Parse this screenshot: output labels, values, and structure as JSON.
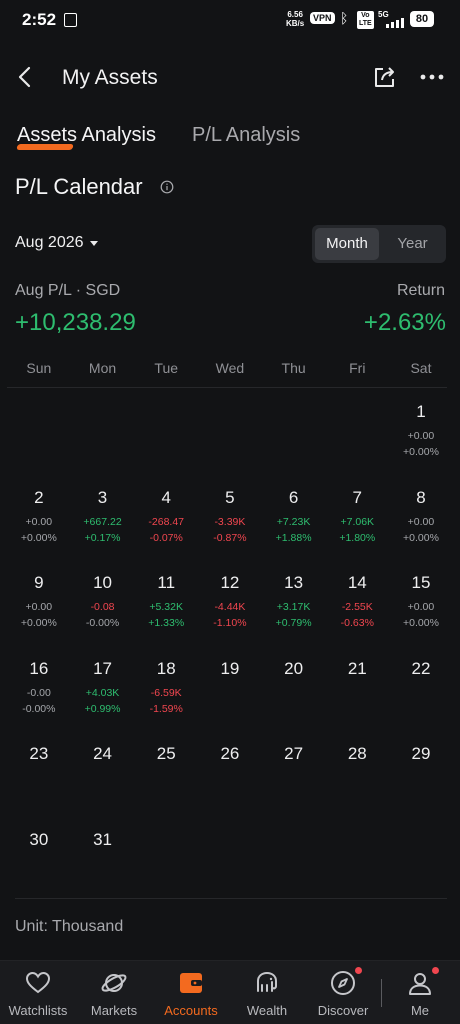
{
  "status_bar": {
    "time": "2:52",
    "net_speed": "6.56",
    "net_unit": "KB/s",
    "vpn": "VPN",
    "volte_top": "Vo",
    "volte_bottom": "LTE",
    "network": "5G",
    "battery": "80"
  },
  "header": {
    "title": "My Assets",
    "back_icon": "chevron-left-icon",
    "share_icon": "share-icon",
    "more_icon": "more-dots-icon"
  },
  "tabs": [
    {
      "label": "Assets Analysis",
      "active": true
    },
    {
      "label": "P/L Analysis",
      "active": false
    }
  ],
  "section": {
    "title": "P/L Calendar",
    "info_icon": "info-icon"
  },
  "period": {
    "selected": "Aug 2026",
    "toggle": [
      "Month",
      "Year"
    ],
    "toggle_active": "Month"
  },
  "summary": {
    "pl_label": "Aug P/L · SGD",
    "pl_value": "+10,238.29",
    "return_label": "Return",
    "return_value": "+2.63%"
  },
  "calendar": {
    "weekdays": [
      "Sun",
      "Mon",
      "Tue",
      "Wed",
      "Thu",
      "Fri",
      "Sat"
    ],
    "weeks": [
      [
        null,
        null,
        null,
        null,
        null,
        null,
        {
          "day": "1",
          "value": "+0.00",
          "pct": "+0.00%",
          "tone": "neutral"
        }
      ],
      [
        {
          "day": "2",
          "value": "+0.00",
          "pct": "+0.00%",
          "tone": "neutral"
        },
        {
          "day": "3",
          "value": "+667.22",
          "pct": "+0.17%",
          "tone": "pos"
        },
        {
          "day": "4",
          "value": "-268.47",
          "pct": "-0.07%",
          "tone": "neg"
        },
        {
          "day": "5",
          "value": "-3.39K",
          "pct": "-0.87%",
          "tone": "neg"
        },
        {
          "day": "6",
          "value": "+7.23K",
          "pct": "+1.88%",
          "tone": "pos"
        },
        {
          "day": "7",
          "value": "+7.06K",
          "pct": "+1.80%",
          "tone": "pos"
        },
        {
          "day": "8",
          "value": "+0.00",
          "pct": "+0.00%",
          "tone": "neutral"
        }
      ],
      [
        {
          "day": "9",
          "value": "+0.00",
          "pct": "+0.00%",
          "tone": "neutral"
        },
        {
          "day": "10",
          "value": "-0.08",
          "pct": "-0.00%",
          "tone": "neg-neutral"
        },
        {
          "day": "11",
          "value": "+5.32K",
          "pct": "+1.33%",
          "tone": "pos"
        },
        {
          "day": "12",
          "value": "-4.44K",
          "pct": "-1.10%",
          "tone": "neg"
        },
        {
          "day": "13",
          "value": "+3.17K",
          "pct": "+0.79%",
          "tone": "pos"
        },
        {
          "day": "14",
          "value": "-2.55K",
          "pct": "-0.63%",
          "tone": "neg"
        },
        {
          "day": "15",
          "value": "+0.00",
          "pct": "+0.00%",
          "tone": "neutral"
        }
      ],
      [
        {
          "day": "16",
          "value": "-0.00",
          "pct": "-0.00%",
          "tone": "neutral"
        },
        {
          "day": "17",
          "value": "+4.03K",
          "pct": "+0.99%",
          "tone": "pos"
        },
        {
          "day": "18",
          "value": "-6.59K",
          "pct": "-1.59%",
          "tone": "neg"
        },
        {
          "day": "19",
          "value": null,
          "pct": null,
          "tone": "neutral"
        },
        {
          "day": "20",
          "value": null,
          "pct": null,
          "tone": "neutral"
        },
        {
          "day": "21",
          "value": null,
          "pct": null,
          "tone": "neutral"
        },
        {
          "day": "22",
          "value": null,
          "pct": null,
          "tone": "neutral"
        }
      ],
      [
        {
          "day": "23",
          "value": null,
          "pct": null,
          "tone": "neutral"
        },
        {
          "day": "24",
          "value": null,
          "pct": null,
          "tone": "neutral"
        },
        {
          "day": "25",
          "value": null,
          "pct": null,
          "tone": "neutral"
        },
        {
          "day": "26",
          "value": null,
          "pct": null,
          "tone": "neutral"
        },
        {
          "day": "27",
          "value": null,
          "pct": null,
          "tone": "neutral"
        },
        {
          "day": "28",
          "value": null,
          "pct": null,
          "tone": "neutral"
        },
        {
          "day": "29",
          "value": null,
          "pct": null,
          "tone": "neutral"
        }
      ],
      [
        {
          "day": "30",
          "value": null,
          "pct": null,
          "tone": "neutral"
        },
        {
          "day": "31",
          "value": null,
          "pct": null,
          "tone": "neutral"
        },
        null,
        null,
        null,
        null,
        null
      ]
    ]
  },
  "footer": {
    "unit": "Unit: Thousand"
  },
  "nav": [
    {
      "label": "Watchlists",
      "icon": "heart-icon",
      "active": false,
      "dot": false
    },
    {
      "label": "Markets",
      "icon": "planet-icon",
      "active": false,
      "dot": false
    },
    {
      "label": "Accounts",
      "icon": "wallet-icon",
      "active": true,
      "dot": false
    },
    {
      "label": "Wealth",
      "icon": "elephant-icon",
      "active": false,
      "dot": false
    },
    {
      "label": "Discover",
      "icon": "compass-icon",
      "active": false,
      "dot": true
    },
    {
      "label": "Me",
      "icon": "person-icon",
      "active": false,
      "dot": true
    }
  ],
  "colors": {
    "background": "#121315",
    "positive": "#2ebd6f",
    "negative": "#f0464f",
    "accent": "#f36a1f",
    "muted": "#a5a7ab"
  }
}
